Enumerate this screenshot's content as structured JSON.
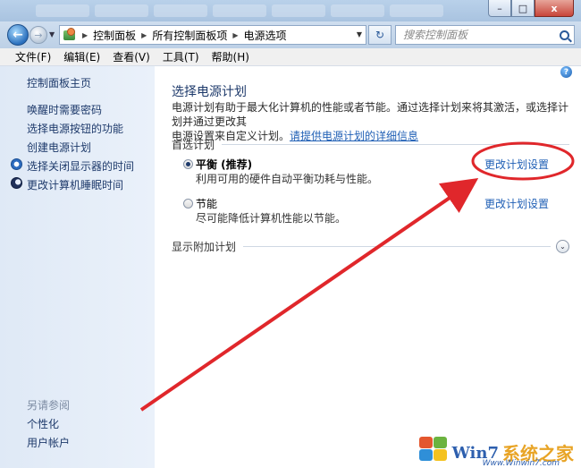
{
  "window": {
    "minimize": "–",
    "maximize": "□",
    "close": "x"
  },
  "nav": {
    "breadcrumbs": [
      "控制面板",
      "所有控制面板项",
      "电源选项"
    ],
    "search_placeholder": "搜索控制面板"
  },
  "menu": [
    "文件(F)",
    "编辑(E)",
    "查看(V)",
    "工具(T)",
    "帮助(H)"
  ],
  "sidebar": {
    "home": "控制面板主页",
    "items": [
      "唤醒时需要密码",
      "选择电源按钮的功能",
      "创建电源计划",
      "选择关闭显示器的时间",
      "更改计算机睡眠时间"
    ],
    "see_also_title": "另请参阅",
    "see_also": [
      "个性化",
      "用户帐户"
    ]
  },
  "main": {
    "title": "选择电源计划",
    "desc_line1": "电源计划有助于最大化计算机的性能或者节能。通过选择计划来将其激活，或选择计划并通过更改其",
    "desc_line2_prefix": "电源设置来自定义计划。",
    "desc_link": "请提供电源计划的详细信息",
    "preferred_label": "首选计划",
    "plans": [
      {
        "name": "平衡 (推荐)",
        "desc": "利用可用的硬件自动平衡功耗与性能。",
        "link": "更改计划设置",
        "selected": true
      },
      {
        "name": "节能",
        "desc": "尽可能降低计算机性能以节能。",
        "link": "更改计划设置",
        "selected": false
      }
    ],
    "more_label": "显示附加计划"
  },
  "watermark": {
    "brand": "Win7",
    "cn": "系统之家",
    "url": "Www.Winwin7.com"
  },
  "colors": {
    "link": "#1f5fb5",
    "annotation_red": "#e0272b"
  }
}
